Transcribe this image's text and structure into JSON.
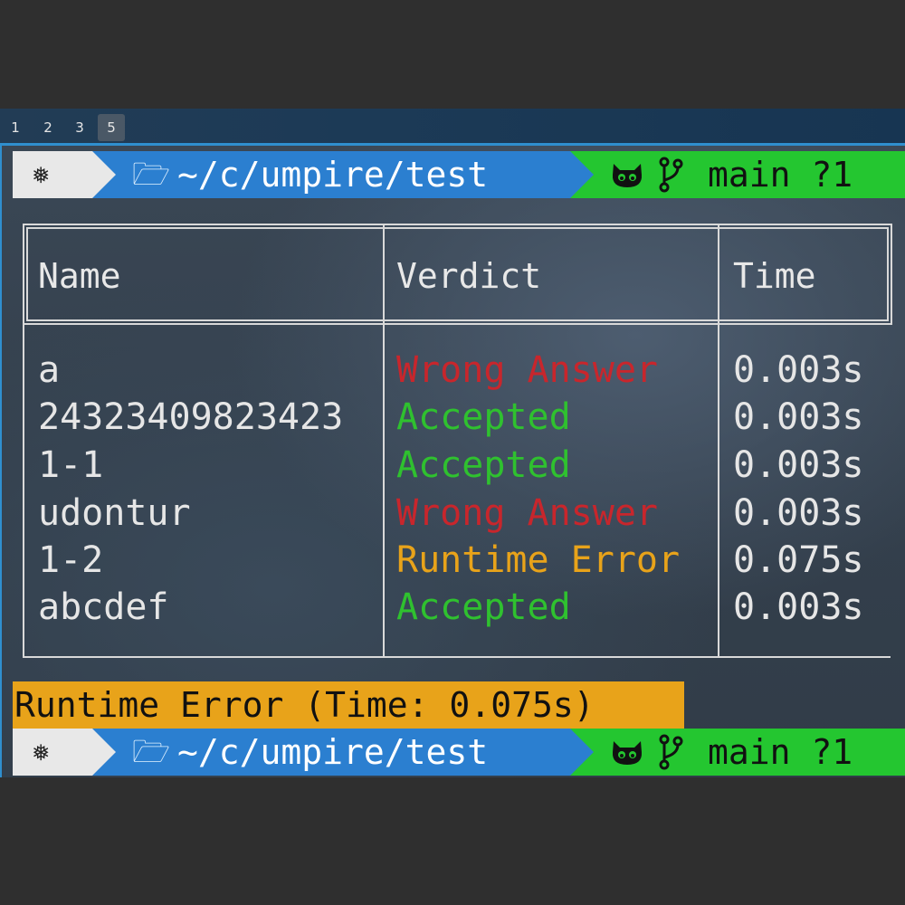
{
  "workspaces": [
    {
      "label": "1",
      "active": false
    },
    {
      "label": "2",
      "active": false
    },
    {
      "label": "3",
      "active": false
    },
    {
      "label": "5",
      "active": true
    }
  ],
  "prompt": {
    "os_icon": "gear-icon",
    "folder_icon": "folder-open-icon",
    "path": "~/c/umpire/test",
    "git_icons": [
      "github-octocat-icon",
      "git-branch-icon"
    ],
    "git_status": "main ?1",
    "colors": {
      "os": "#e8e8e8",
      "path": "#2b7fd0",
      "git": "#24c630"
    }
  },
  "table": {
    "headers": {
      "name": "Name",
      "verdict": "Verdict",
      "time": "Time"
    },
    "rows": [
      {
        "name": "a",
        "verdict": "Wrong Answer",
        "status": "wrong",
        "time": "0.003s"
      },
      {
        "name": "24323409823423",
        "verdict": "Accepted",
        "status": "accepted",
        "time": "0.003s"
      },
      {
        "name": "1-1",
        "verdict": "Accepted",
        "status": "accepted",
        "time": "0.003s"
      },
      {
        "name": "udontur",
        "verdict": "Wrong Answer",
        "status": "wrong",
        "time": "0.003s"
      },
      {
        "name": "1-2",
        "verdict": "Runtime Error",
        "status": "runtime",
        "time": "0.075s"
      },
      {
        "name": "abcdef",
        "verdict": "Accepted",
        "status": "accepted",
        "time": "0.003s"
      }
    ],
    "status_colors": {
      "wrong": "#c8262c",
      "accepted": "#2fc12f",
      "runtime": "#e8a31a"
    }
  },
  "summary": "Runtime Error (Time: 0.075s)"
}
